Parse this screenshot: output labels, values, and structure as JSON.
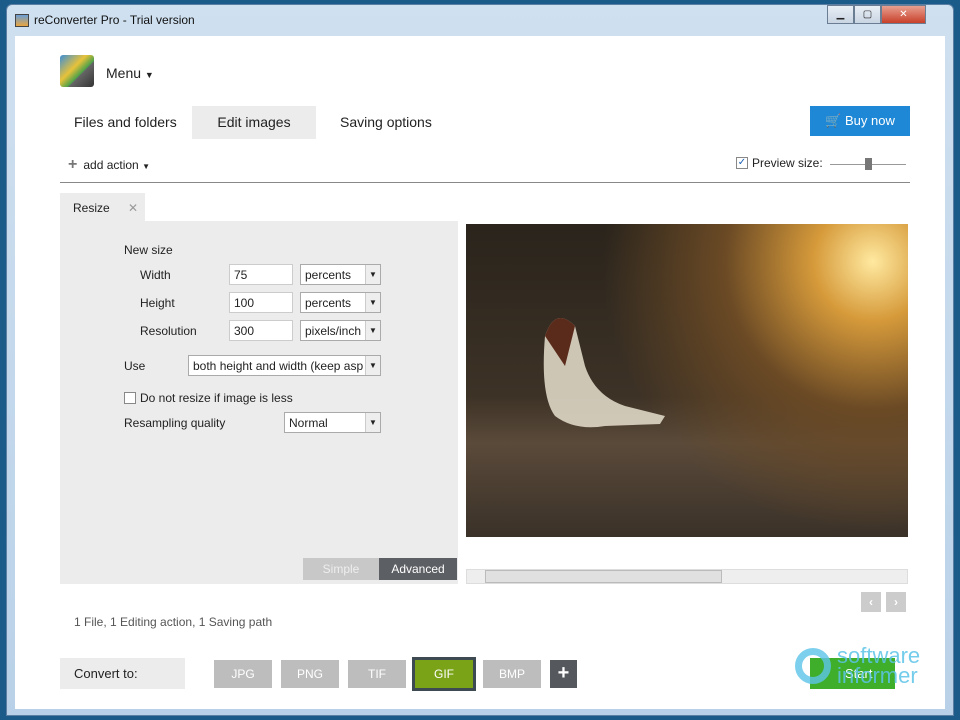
{
  "window": {
    "title": "reConverter Pro - Trial version",
    "controls": [
      "minimize",
      "maximize",
      "close"
    ]
  },
  "header": {
    "menu_label": "Menu",
    "tabs": [
      {
        "label": "Files and folders"
      },
      {
        "label": "Edit images",
        "active": true
      },
      {
        "label": "Saving options"
      }
    ],
    "buy_label": "Buy now"
  },
  "toolbar": {
    "add_action": "add action",
    "preview_size_label": "Preview size:",
    "preview_checked": true,
    "preview_size_level": 0.5
  },
  "action_tab": {
    "label": "Resize"
  },
  "resize": {
    "new_size": "New size",
    "width_label": "Width",
    "width_value": "75",
    "width_unit": "percents",
    "height_label": "Height",
    "height_value": "100",
    "height_unit": "percents",
    "resolution_label": "Resolution",
    "resolution_value": "300",
    "resolution_unit": "pixels/inch",
    "use_label": "Use",
    "use_value": "both height and width (keep asp",
    "no_resize_label": "Do not resize if image is less",
    "no_resize_checked": false,
    "resampling_label": "Resampling quality",
    "resampling_value": "Normal",
    "mode_simple": "Simple",
    "mode_advanced": "Advanced"
  },
  "status": {
    "text": "1 File, 1 Editing action, 1 Saving path"
  },
  "bottom": {
    "convert_label": "Convert to:",
    "formats": [
      "JPG",
      "PNG",
      "TIF",
      "GIF",
      "BMP"
    ],
    "selected": "GIF",
    "start_label": "Start",
    "add_format": "+"
  },
  "watermark": {
    "text1": "software",
    "text2": "informer"
  },
  "colors": {
    "accent": "#1e88d6",
    "selected_format": "#7aa317",
    "start": "#3fae2a"
  }
}
